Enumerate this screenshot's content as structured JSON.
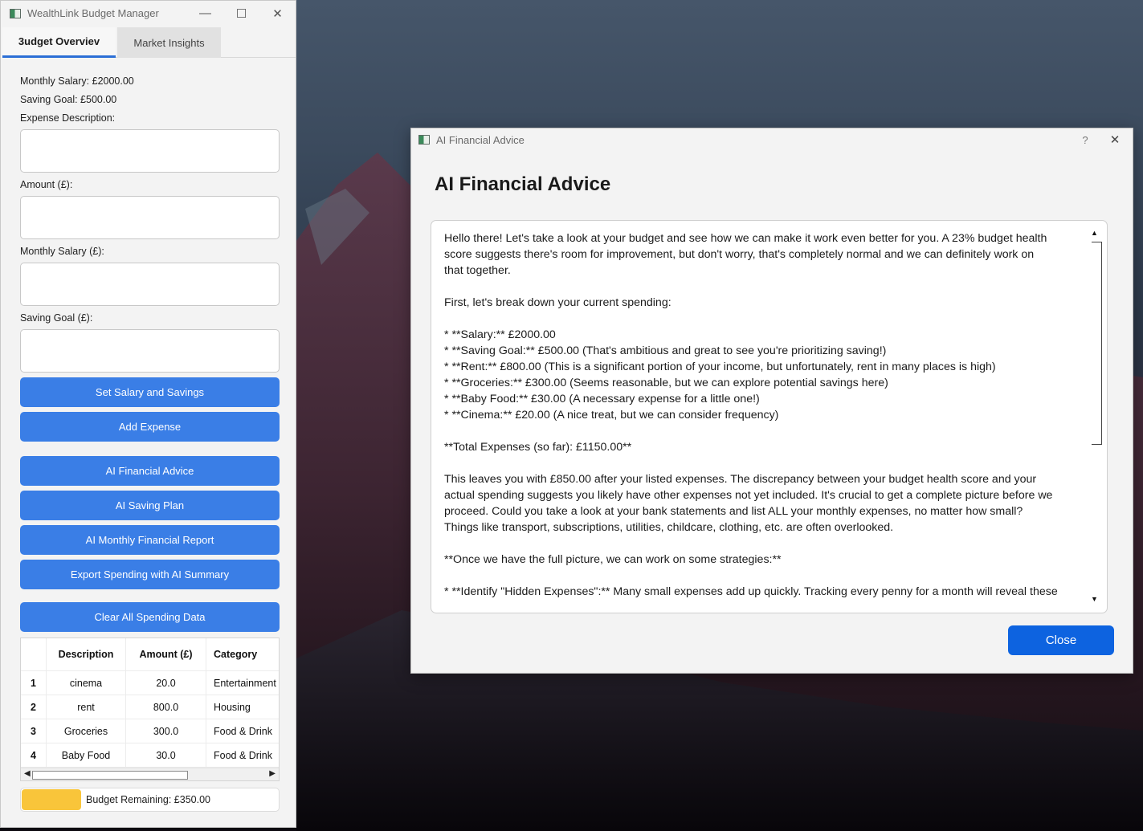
{
  "main_window": {
    "title": "WealthLink Budget Manager",
    "controls": {
      "minimize": "—",
      "maximize": "☐",
      "close": "✕"
    },
    "tabs": [
      {
        "label": "Budget Overview",
        "visible": "3udget Overviev",
        "selected": true
      },
      {
        "label": "Market Insights",
        "visible": "Market Insights",
        "selected": false
      }
    ],
    "info": {
      "monthly_salary": "Monthly Salary: £2000.00",
      "saving_goal": "Saving Goal: £500.00"
    },
    "form": {
      "expense_description_label": "Expense Description:",
      "amount_label": "Amount (£):",
      "monthly_salary_label": "Monthly Salary (£):",
      "saving_goal_label": "Saving Goal (£):"
    },
    "buttons": {
      "set_salary": "Set Salary and Savings",
      "add_expense": "Add Expense",
      "ai_advice": "AI Financial Advice",
      "ai_saving_plan": "AI Saving Plan",
      "ai_monthly_report": "AI Monthly Financial Report",
      "export_spending": "Export Spending with AI Summary",
      "clear_all": "Clear All Spending Data"
    },
    "table": {
      "headers": [
        "Description",
        "Amount (£)",
        "Category"
      ],
      "rows": [
        {
          "index": "1",
          "description": "cinema",
          "amount": "20.0",
          "category": "Entertainment"
        },
        {
          "index": "2",
          "description": "rent",
          "amount": "800.0",
          "category": "Housing"
        },
        {
          "index": "3",
          "description": "Groceries",
          "amount": "300.0",
          "category": "Food & Drink"
        },
        {
          "index": "4",
          "description": "Baby Food",
          "amount": "30.0",
          "category": "Food & Drink"
        }
      ]
    },
    "budget_remaining": {
      "text": "Budget Remaining: £350.00",
      "fill_fraction": 0.23,
      "color": "#f9c53a"
    }
  },
  "dialog": {
    "title": "AI Financial Advice",
    "help": "?",
    "close_x": "✕",
    "heading": "AI Financial Advice",
    "advice_lines": [
      "Hello there!  Let's take a look at your budget and see how we can make it work even better for you.  A 23% budget health",
      "score suggests there's room for improvement, but don't worry, that's completely normal and we can definitely work on",
      "that together.",
      "",
      "First, let's break down your current spending:",
      "",
      "* **Salary:** £2000.00",
      "* **Saving Goal:** £500.00  (That's ambitious and great to see you're prioritizing saving!)",
      "* **Rent:** £800.00 (This is a significant portion of your income, but unfortunately, rent in many places is high)",
      "* **Groceries:** £300.00 (Seems reasonable, but we can explore potential savings here)",
      "* **Baby Food:** £30.00 (A necessary expense for a little one!)",
      "* **Cinema:** £20.00 (A nice treat, but we can consider frequency)",
      "",
      "**Total Expenses (so far): £1150.00**",
      "",
      "This leaves you with £850.00  after your listed expenses.  The discrepancy between your budget health score and your",
      "actual spending suggests you likely have other expenses not yet included.  It's crucial to get a complete picture before we",
      "proceed.  Could you take a look at your bank statements and list ALL your monthly expenses, no matter how small?",
      "Things like transport, subscriptions, utilities, childcare, clothing, etc. are often overlooked.",
      "",
      "**Once we have the full picture, we can work on some strategies:**",
      "",
      "* **Identify \"Hidden Expenses\":**  Many small expenses add up quickly. Tracking every penny for a month will reveal these"
    ],
    "close_button": "Close",
    "accent_color": "#0d63e0"
  },
  "colors": {
    "button_blue": "#3a7ee6",
    "tab_underline": "#2b6fd6"
  }
}
